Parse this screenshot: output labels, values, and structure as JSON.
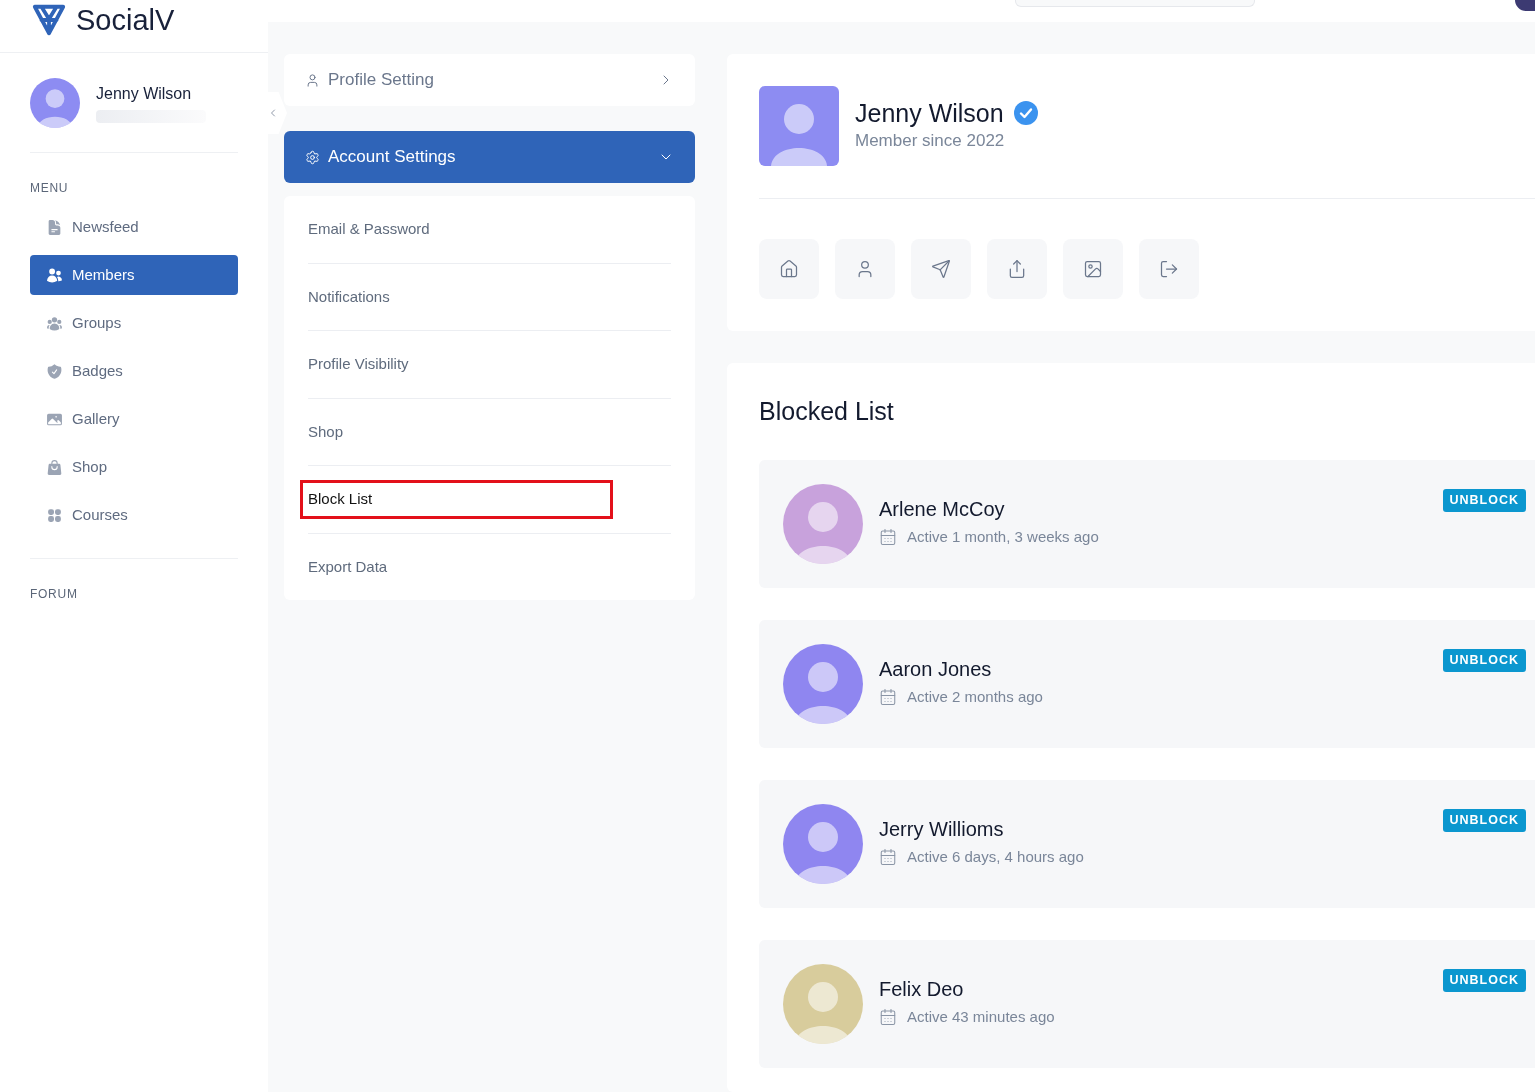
{
  "logo": {
    "text": "SocialV"
  },
  "sidebar": {
    "user": {
      "name": "Jenny Wilson"
    },
    "sections": [
      {
        "title": "MENU",
        "items": [
          {
            "label": "Newsfeed",
            "selected": false
          },
          {
            "label": "Members",
            "selected": true
          },
          {
            "label": "Groups",
            "selected": false
          },
          {
            "label": "Badges",
            "selected": false
          },
          {
            "label": "Gallery",
            "selected": false
          },
          {
            "label": "Shop",
            "selected": false
          },
          {
            "label": "Courses",
            "selected": false
          }
        ]
      },
      {
        "title": "FORUM"
      }
    ]
  },
  "settings": {
    "profile_setting": {
      "label": "Profile Setting",
      "expanded": false
    },
    "account_settings": {
      "label": "Account Settings",
      "expanded": true,
      "items": [
        {
          "label": "Email & Password",
          "selected": false
        },
        {
          "label": "Notifications",
          "selected": false
        },
        {
          "label": "Profile Visibility",
          "selected": false
        },
        {
          "label": "Shop",
          "selected": false
        },
        {
          "label": "Block List",
          "selected": true
        },
        {
          "label": "Export Data",
          "selected": false
        }
      ]
    }
  },
  "profile": {
    "name": "Jenny Wilson",
    "verified": true,
    "member_since": "Member since 2022"
  },
  "blocked_list": {
    "title": "Blocked List",
    "items": [
      {
        "name": "Arlene McCoy",
        "status": "Active 1 month, 3 weeks ago",
        "button": "UNBLOCK",
        "color": "#c8a2dc"
      },
      {
        "name": "Aaron Jones",
        "status": "Active 2 months ago",
        "button": "UNBLOCK",
        "color": "#8f86f0"
      },
      {
        "name": "Jerry Willioms",
        "status": "Active 6 days, 4 hours ago",
        "button": "UNBLOCK",
        "color": "#8f86f0"
      },
      {
        "name": "Felix Deo",
        "status": "Active 43 minutes ago",
        "button": "UNBLOCK",
        "color": "#d8cc9c"
      }
    ]
  }
}
